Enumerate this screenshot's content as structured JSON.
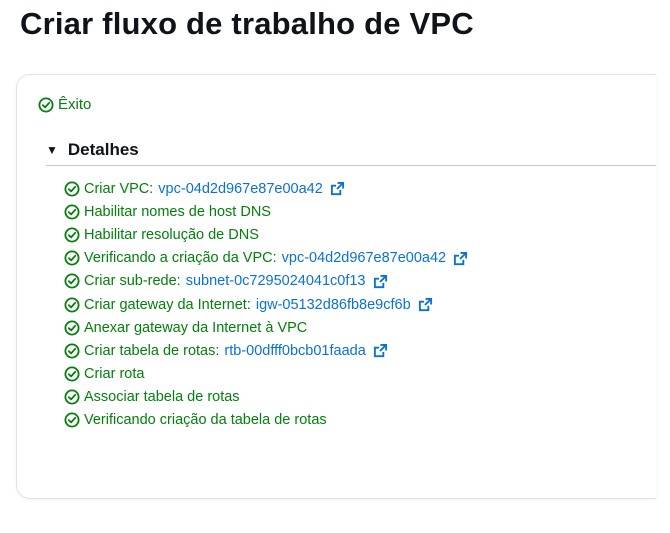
{
  "page": {
    "title": "Criar fluxo de trabalho de VPC"
  },
  "status": {
    "label": "Êxito"
  },
  "details": {
    "header": "Detalhes",
    "steps": [
      {
        "text": "Criar VPC:",
        "link": "vpc-04d2d967e87e00a42",
        "external": true
      },
      {
        "text": "Habilitar nomes de host DNS",
        "link": null,
        "external": false
      },
      {
        "text": "Habilitar resolução de DNS",
        "link": null,
        "external": false
      },
      {
        "text": "Verificando a criação da VPC:",
        "link": "vpc-04d2d967e87e00a42",
        "external": true
      },
      {
        "text": "Criar sub-rede:",
        "link": "subnet-0c7295024041c0f13",
        "external": true
      },
      {
        "text": "Criar gateway da Internet:",
        "link": "igw-05132d86fb8e9cf6b",
        "external": true
      },
      {
        "text": "Anexar gateway da Internet à VPC",
        "link": null,
        "external": false
      },
      {
        "text": "Criar tabela de rotas:",
        "link": "rtb-00dfff0bcb01faada",
        "external": true
      },
      {
        "text": "Criar rota",
        "link": null,
        "external": false
      },
      {
        "text": "Associar tabela de rotas",
        "link": null,
        "external": false
      },
      {
        "text": "Verificando criação da tabela de rotas",
        "link": null,
        "external": false
      }
    ]
  },
  "colors": {
    "success": "#037f0c",
    "link": "#0972d3",
    "title": "#0f141a"
  },
  "icons": {
    "step_status": "check-circle-icon",
    "external": "external-link-icon",
    "toggle": "caret-down-icon"
  }
}
